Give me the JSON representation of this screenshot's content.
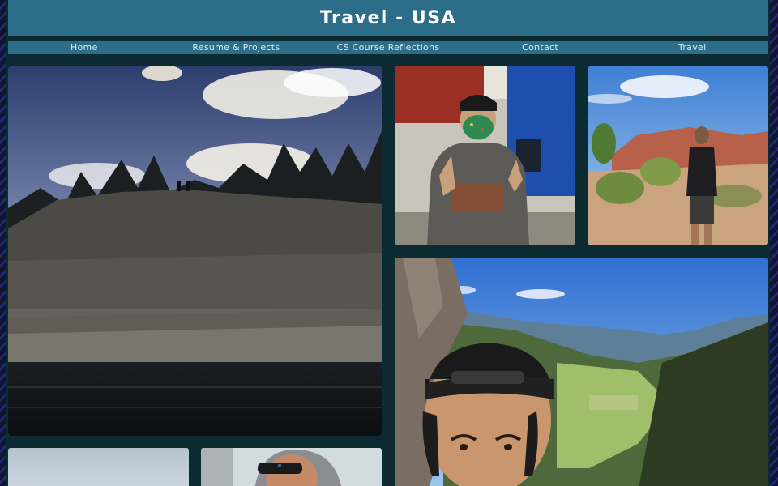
{
  "header": {
    "title": "Travel - USA"
  },
  "nav": {
    "items": [
      {
        "label": "Home"
      },
      {
        "label": "Resume & Projects"
      },
      {
        "label": "CS Course Reflections"
      },
      {
        "label": "Contact"
      },
      {
        "label": "Travel"
      }
    ]
  },
  "gallery": {
    "photos": [
      {
        "subject": "lake-cliff-sunset"
      },
      {
        "subject": "masked-person-gym"
      },
      {
        "subject": "desert-red-rocks"
      },
      {
        "subject": "mountain-valley-selfie"
      },
      {
        "subject": "snowy-sky"
      },
      {
        "subject": "hooded-person-sunglasses"
      }
    ]
  },
  "colors": {
    "header_bg": "#2c6e8a",
    "page_bg": "#0b2a31",
    "nav_text": "#d4ecf4"
  }
}
